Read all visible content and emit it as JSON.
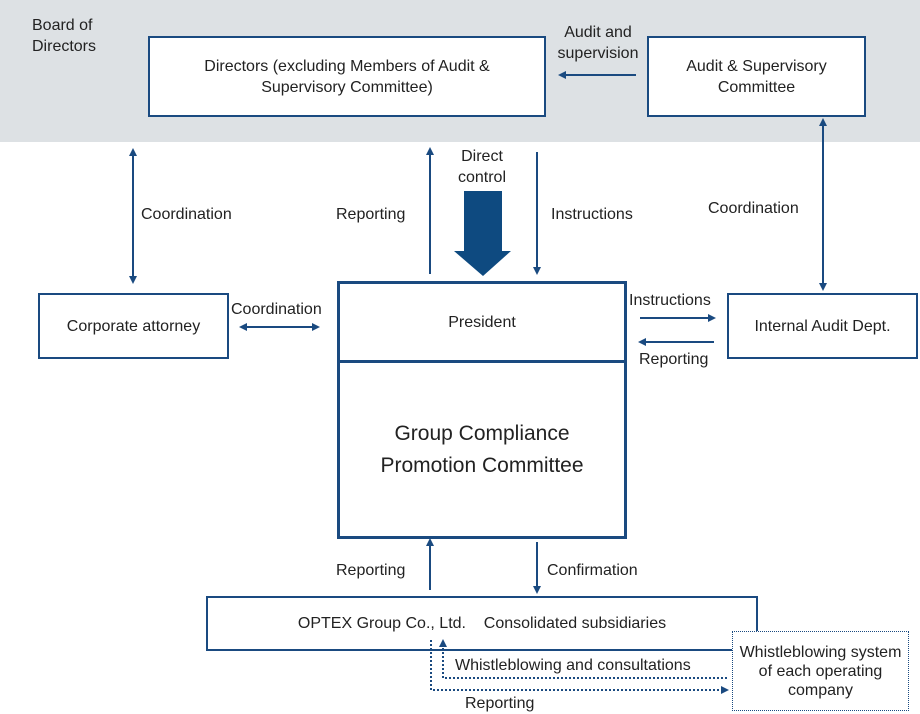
{
  "board_label": "Board of\nDirectors",
  "boxes": {
    "directors": "Directors (excluding Members of Audit & Supervisory Committee)",
    "audit_committee": "Audit & Supervisory Committee",
    "corporate_attorney": "Corporate attorney",
    "president": "President",
    "compliance_committee": "Group Compliance Promotion Committee",
    "internal_audit": "Internal Audit Dept.",
    "group": "OPTEX Group Co., Ltd.    Consolidated subsidiaries",
    "whistleblowing_system": "Whistleblowing system of each operating company"
  },
  "labels": {
    "audit_supervision": "Audit and supervision",
    "coordination_left": "Coordination",
    "reporting_top": "Reporting",
    "direct_control": "Direct control",
    "instructions_top": "Instructions",
    "coordination_right": "Coordination",
    "coordination_attorney": "Coordination",
    "instructions_right": "Instructions",
    "reporting_right": "Reporting",
    "reporting_bottom": "Reporting",
    "confirmation": "Confirmation",
    "whistleblowing_consultations": "Whistleblowing and consultations",
    "reporting_dotted": "Reporting"
  },
  "colors": {
    "navy": "#1a4a80",
    "band": "#dde1e4"
  }
}
